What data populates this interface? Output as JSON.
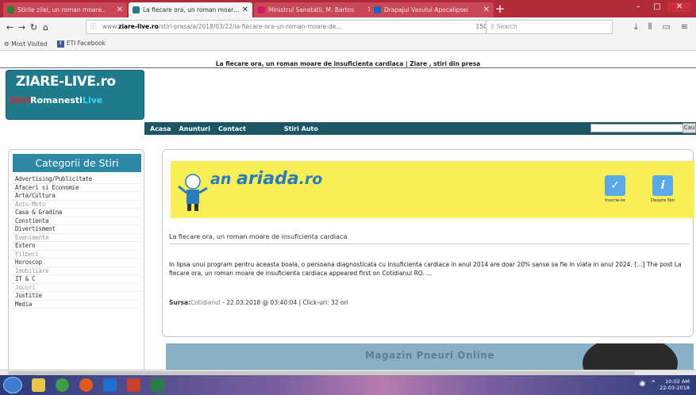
{
  "browser": {
    "tabs": [
      {
        "label": "Stirile zilei, un roman moare..",
        "favicon_color": "#2e7d32",
        "active": false
      },
      {
        "label": "La fiecare ora, un roman moare de...",
        "favicon_color": "#1f7b8c",
        "active": true
      },
      {
        "label": "Ministrul Sanatatii, M. Bartos",
        "favicon_color": "#d81b60",
        "active": false
      },
      {
        "label": "Drapajul Vasului Apocalipsei",
        "favicon_color": "#1565c0",
        "active": false
      }
    ],
    "new_tab_symbol": "+",
    "window_controls": {
      "minimize": "–",
      "maximize": "□",
      "close": "✕"
    },
    "url_prefix": "www.",
    "url_domain": "ziare-live.ro",
    "url_rest": "/stiri-presa/a/2018/03/22/la-fiecare-ora-un-roman-moare-de...",
    "url_reader": "150%",
    "search_placeholder": "Search",
    "bookmarks": [
      "Most Visited",
      "ETI Facebook"
    ]
  },
  "page": {
    "header_title": "La fiecare ora, un roman moare de insuficienta cardiaca | Ziare , stiri din presa",
    "logo_line1": "ZIARE-LIVE.ro",
    "logo_stiri": "Stiri",
    "logo_romanesti": "Romanesti",
    "logo_live": "Live",
    "menu": [
      "Acasa",
      "Anunturi",
      "Contact",
      "Stiri Auto"
    ],
    "search_button": "Cau",
    "sidebar_title": "Categorii de Stiri",
    "categories": [
      {
        "label": "Advertising/Publicitate",
        "dim": false
      },
      {
        "label": "Afaceri si Economie",
        "dim": false
      },
      {
        "label": "Arta/Cultura",
        "dim": false
      },
      {
        "label": "Auto-Moto",
        "dim": true
      },
      {
        "label": "Casa & Gradina",
        "dim": false
      },
      {
        "label": "Constienta",
        "dim": false
      },
      {
        "label": "Divertisment",
        "dim": false
      },
      {
        "label": "Evenimente",
        "dim": true
      },
      {
        "label": "Extern",
        "dim": false
      },
      {
        "label": "Filbeci",
        "dim": true
      },
      {
        "label": "Horoscop",
        "dim": false
      },
      {
        "label": "Imobiliare",
        "dim": true
      },
      {
        "label": "IT & C",
        "dim": false
      },
      {
        "label": "Jocuri",
        "dim": true
      },
      {
        "label": "Justitie",
        "dim": false
      },
      {
        "label": "Media",
        "dim": false
      }
    ],
    "banner": {
      "brand_part1": "an",
      "brand_part2": "ariada",
      "brand_part3": ".ro",
      "icon1_label": "Inscrie-te",
      "icon2_label": "Despre Noi"
    },
    "article": {
      "title": "La fiecare ora, un roman moare de insuficienta cardiaca",
      "body": "In lipsa unui program pentru aceasta boala, o persoana diagnosticata cu insuficienta cardiaca in anul 2014 are doar 20% sanse sa fie in viata in anul 2024. […] The post La fiecare ora, un roman moare de insuficienta cardiaca appeared first on Cotidianul RO. ...",
      "source_label": "Sursa:",
      "source_name": "Cotidianul",
      "date": " - 22.03.2018 @ 03:40:04 | ",
      "clicks_label": "Click-uri:",
      "clicks_value": " 32 ori"
    },
    "ad_text": "Magazin Pneuri Online"
  },
  "taskbar": {
    "time": "10:02 AM",
    "date": "22-03-2018"
  }
}
